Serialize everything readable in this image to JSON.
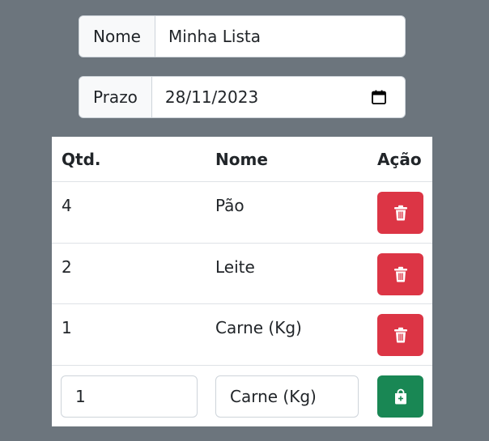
{
  "form": {
    "nome_label": "Nome",
    "nome_value": "Minha Lista",
    "prazo_label": "Prazo",
    "prazo_value": "28/11/2023"
  },
  "table": {
    "headers": {
      "qtd": "Qtd.",
      "nome": "Nome",
      "acao": "Ação"
    },
    "rows": [
      {
        "qtd": "4",
        "nome": "Pão"
      },
      {
        "qtd": "2",
        "nome": "Leite"
      },
      {
        "qtd": "1",
        "nome": "Carne (Kg)"
      }
    ],
    "new_item": {
      "qtd": "1",
      "nome": "Carne (Kg)"
    }
  },
  "icons": {
    "delete": "trash-icon",
    "add": "bag-plus-icon",
    "calendar": "calendar-icon"
  },
  "colors": {
    "background": "#6c757d",
    "danger": "#dc3545",
    "success": "#198754"
  }
}
